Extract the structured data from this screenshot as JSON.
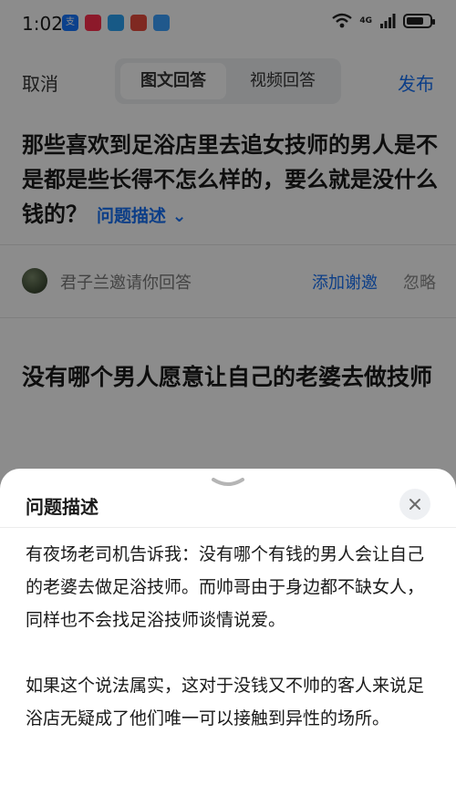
{
  "status_bar": {
    "time": "1:02",
    "app_icons": [
      {
        "icon": "alipay-icon",
        "glyph": "支",
        "color": "#1677ff"
      },
      {
        "icon": "taobao-icon",
        "glyph": "",
        "color": "#ff2e4d"
      },
      {
        "icon": "message-icon",
        "glyph": "",
        "color": "#2aa3f4"
      },
      {
        "icon": "shop-icon",
        "glyph": "",
        "color": "#e84c3d"
      },
      {
        "icon": "browser-icon",
        "glyph": "",
        "color": "#3ba0ff"
      }
    ],
    "network": "4G"
  },
  "top_bar": {
    "cancel_label": "取消",
    "tabs": [
      {
        "label": "图文回答",
        "active": true
      },
      {
        "label": "视频回答",
        "active": false
      }
    ],
    "publish_label": "发布"
  },
  "question": {
    "title": "那些喜欢到足浴店里去追女技师的男人是不是都是些长得不怎么样的，要么就是没什么钱的？",
    "desc_toggle": "问题描述 ⌄"
  },
  "invite": {
    "text": "君子兰邀请你回答",
    "thank_label": "添加谢邀",
    "ignore_label": "忽略"
  },
  "answer": {
    "title": "没有哪个男人愿意让自己的老婆去做技师"
  },
  "sheet": {
    "title": "问题描述",
    "paragraphs": [
      "有夜场老司机告诉我：没有哪个有钱的男人会让自己的老婆去做足浴技师。而帅哥由于身边都不缺女人，同样也不会找足浴技师谈情说爱。",
      "如果这个说法属实，这对于没钱又不帅的客人来说足浴店无疑成了他们唯一可以接触到异性的场所。"
    ]
  },
  "colors": {
    "accent": "#1772f6",
    "overlay": "rgba(0,0,0,0.45)"
  }
}
